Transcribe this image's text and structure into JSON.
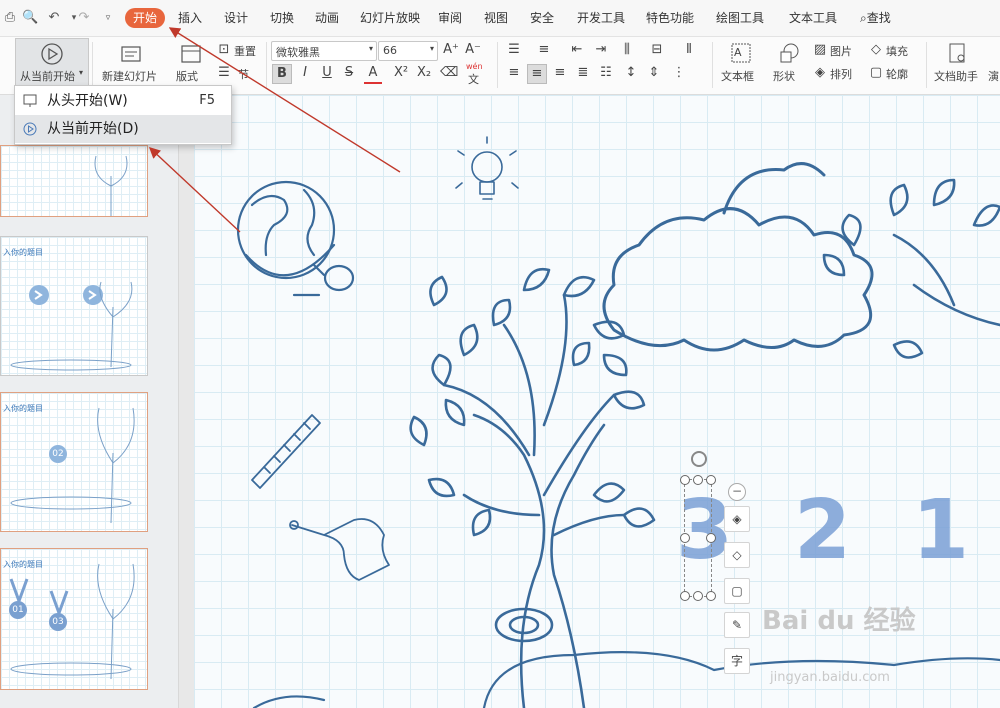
{
  "quick_access": {
    "print_icon": "print-icon",
    "preview_icon": "print-preview-icon",
    "undo_icon": "undo-icon",
    "redo_icon": "redo-icon",
    "more_icon": "customize-icon"
  },
  "menu_tabs": [
    {
      "label": "开始",
      "active": true
    },
    {
      "label": "插入"
    },
    {
      "label": "设计"
    },
    {
      "label": "切换"
    },
    {
      "label": "动画"
    },
    {
      "label": "幻灯片放映"
    },
    {
      "label": "审阅"
    },
    {
      "label": "视图"
    },
    {
      "label": "安全"
    },
    {
      "label": "开发工具"
    },
    {
      "label": "特色功能"
    },
    {
      "label": "绘图工具"
    },
    {
      "label": "文本工具"
    },
    {
      "label": "查找"
    }
  ],
  "ribbon": {
    "play_from_current": "从当前开始",
    "new_slide": "新建幻灯片",
    "layout": "版式",
    "reset": "重置",
    "section": "节",
    "font_name": "微软雅黑",
    "font_size": "66",
    "textbox": "文本框",
    "shape": "形状",
    "picture": "图片",
    "arrange": "排列",
    "fill": "填充",
    "outline": "轮廓",
    "doc_assistant": "文档助手",
    "cut_text": "演",
    "text_a": "A",
    "wen": "wén",
    "wen_char": "文"
  },
  "dropdown": {
    "items": [
      {
        "label": "从头开始(W)",
        "shortcut": "F5"
      },
      {
        "label": "从当前开始(D)",
        "shortcut": ""
      }
    ]
  },
  "thumbnails": {
    "titles": [
      "入你的题目",
      "入你的题目",
      "入你的题目"
    ],
    "badges": [
      "02",
      "01",
      "03"
    ]
  },
  "slide": {
    "digits": [
      "3",
      "2",
      "1"
    ],
    "char_tool": "字",
    "minus": "−"
  },
  "watermark": {
    "text": "Bai du 经验",
    "sub": "jingyan.baidu.com"
  },
  "colors": {
    "accent": "#e8663d",
    "ink": "#3a6a9a",
    "digit": "#7ba0d6",
    "arrow": "#c0392b"
  }
}
